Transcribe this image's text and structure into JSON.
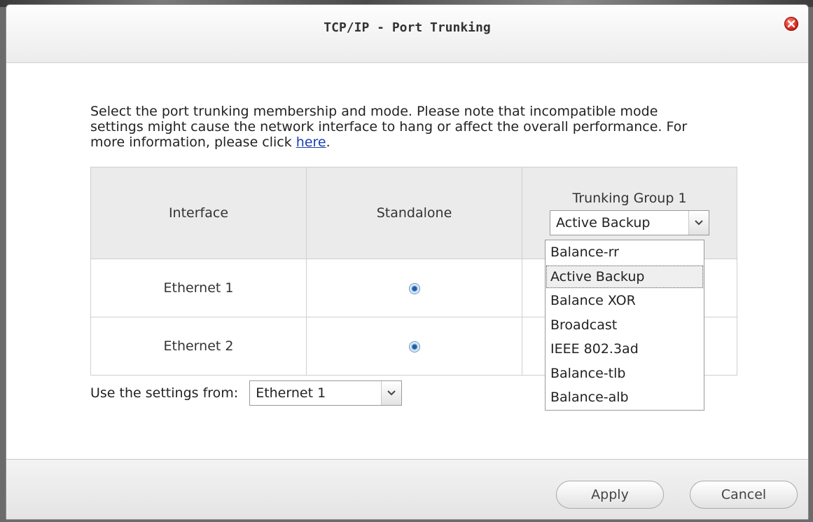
{
  "dialog": {
    "title": "TCP/IP - Port Trunking",
    "intro_text": "Select the port trunking membership and mode. Please note that incompatible mode settings might cause the network interface to hang or affect the overall performance. For more information, please click ",
    "intro_link": "here",
    "intro_end": "."
  },
  "table": {
    "headers": {
      "interface": "Interface",
      "standalone": "Standalone",
      "group": "Trunking Group 1"
    },
    "group_mode_selected": "Active Backup",
    "rows": [
      {
        "interface": "Ethernet 1",
        "standalone_selected": true
      },
      {
        "interface": "Ethernet 2",
        "standalone_selected": true
      }
    ]
  },
  "mode_options": [
    "Balance-rr",
    "Active Backup",
    "Balance XOR",
    "Broadcast",
    "IEEE 802.3ad",
    "Balance-tlb",
    "Balance-alb"
  ],
  "mode_highlighted": "Active Backup",
  "settings": {
    "label": "Use the settings from:",
    "selected": "Ethernet 1"
  },
  "footer": {
    "apply_label": "Apply",
    "cancel_label": "Cancel"
  },
  "icons": {
    "close": "close-icon",
    "dropdown": "chevron-down-icon",
    "radio": "radio-button"
  },
  "colors": {
    "close_red": "#d8281c",
    "link_blue": "#1a3fb5",
    "radio_blue": "#1f5fa5"
  }
}
